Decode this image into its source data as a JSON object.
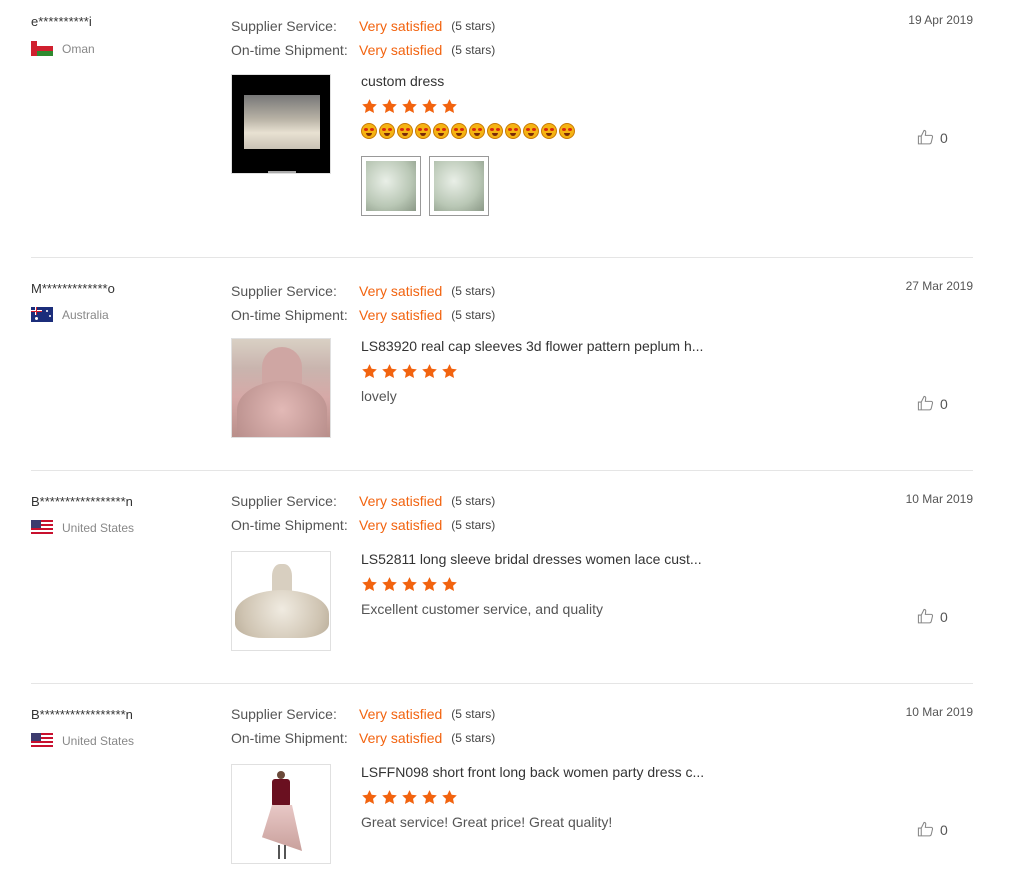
{
  "reviews": [
    {
      "user": "e**********i",
      "country": "Oman",
      "supplier_label": "Supplier Service:",
      "supplier_value": "Very satisfied",
      "supplier_stars": "(5 stars)",
      "shipment_label": "On-time Shipment:",
      "shipment_value": "Very satisfied",
      "shipment_stars": "(5 stars)",
      "date": "19 Apr 2019",
      "product_title": "custom dress",
      "comment": "",
      "likes": "0"
    },
    {
      "user": "M*************o",
      "country": "Australia",
      "supplier_label": "Supplier Service:",
      "supplier_value": "Very satisfied",
      "supplier_stars": "(5 stars)",
      "shipment_label": "On-time Shipment:",
      "shipment_value": "Very satisfied",
      "shipment_stars": "(5 stars)",
      "date": "27 Mar 2019",
      "product_title": "LS83920 real cap sleeves 3d flower pattern peplum h...",
      "comment": "lovely",
      "likes": "0"
    },
    {
      "user": "B*****************n",
      "country": "United States",
      "supplier_label": "Supplier Service:",
      "supplier_value": "Very satisfied",
      "supplier_stars": "(5 stars)",
      "shipment_label": "On-time Shipment:",
      "shipment_value": "Very satisfied",
      "shipment_stars": "(5 stars)",
      "date": "10 Mar 2019",
      "product_title": "LS52811 long sleeve bridal dresses women lace cust...",
      "comment": "Excellent customer service, and quality",
      "likes": "0"
    },
    {
      "user": "B*****************n",
      "country": "United States",
      "supplier_label": "Supplier Service:",
      "supplier_value": "Very satisfied",
      "supplier_stars": "(5 stars)",
      "shipment_label": "On-time Shipment:",
      "shipment_value": "Very satisfied",
      "shipment_stars": "(5 stars)",
      "date": "10 Mar 2019",
      "product_title": "LSFFN098 short front long back women party dress c...",
      "comment": "Great service! Great price! Great quality!",
      "likes": "0"
    }
  ],
  "colors": {
    "accent": "#f2630f",
    "divider": "#e5e5e5"
  },
  "star_rating": 5,
  "icons": [
    "star-icon",
    "thumbs-up-icon",
    "flag-icon",
    "heart-eyes-emoji"
  ]
}
